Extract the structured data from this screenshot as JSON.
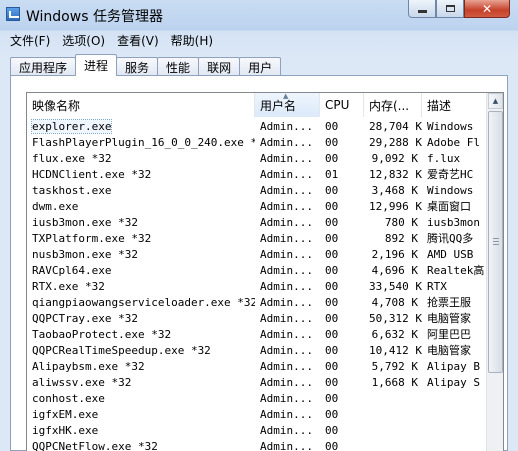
{
  "window": {
    "title": "Windows 任务管理器"
  },
  "menu": [
    "文件(F)",
    "选项(O)",
    "查看(V)",
    "帮助(H)"
  ],
  "tabs": [
    {
      "label": "应用程序",
      "active": false
    },
    {
      "label": "进程",
      "active": true
    },
    {
      "label": "服务",
      "active": false
    },
    {
      "label": "性能",
      "active": false
    },
    {
      "label": "联网",
      "active": false
    },
    {
      "label": "用户",
      "active": false
    }
  ],
  "columns": [
    "映像名称",
    "用户名",
    "CPU",
    "内存(...",
    "描述"
  ],
  "sorted_column": "用户名",
  "rows": [
    {
      "name": "explorer.exe",
      "user": "Admin...",
      "cpu": "00",
      "mem": "28,704 K",
      "desc": "Windows"
    },
    {
      "name": "FlashPlayerPlugin_16_0_0_240.exe *32",
      "user": "Admin...",
      "cpu": "00",
      "mem": "29,288 K",
      "desc": "Adobe Fl"
    },
    {
      "name": "flux.exe *32",
      "user": "Admin...",
      "cpu": "00",
      "mem": "9,092 K",
      "desc": "f.lux"
    },
    {
      "name": "HCDNClient.exe *32",
      "user": "Admin...",
      "cpu": "01",
      "mem": "12,832 K",
      "desc": "爱奇艺HC"
    },
    {
      "name": "taskhost.exe",
      "user": "Admin...",
      "cpu": "00",
      "mem": "3,468 K",
      "desc": "Windows"
    },
    {
      "name": "dwm.exe",
      "user": "Admin...",
      "cpu": "00",
      "mem": "12,996 K",
      "desc": "桌面窗口"
    },
    {
      "name": "iusb3mon.exe *32",
      "user": "Admin...",
      "cpu": "00",
      "mem": "780 K",
      "desc": "iusb3mon"
    },
    {
      "name": "TXPlatform.exe *32",
      "user": "Admin...",
      "cpu": "00",
      "mem": "892 K",
      "desc": "腾讯QQ多"
    },
    {
      "name": "nusb3mon.exe *32",
      "user": "Admin...",
      "cpu": "00",
      "mem": "2,196 K",
      "desc": "AMD USB"
    },
    {
      "name": "RAVCpl64.exe",
      "user": "Admin...",
      "cpu": "00",
      "mem": "4,696 K",
      "desc": "Realtek高"
    },
    {
      "name": "RTX.exe *32",
      "user": "Admin...",
      "cpu": "00",
      "mem": "33,540 K",
      "desc": "RTX"
    },
    {
      "name": "qiangpiaowangserviceloader.exe *32",
      "user": "Admin...",
      "cpu": "00",
      "mem": "4,708 K",
      "desc": "抢票王服"
    },
    {
      "name": "QQPCTray.exe *32",
      "user": "Admin...",
      "cpu": "00",
      "mem": "50,312 K",
      "desc": "电脑管家"
    },
    {
      "name": "TaobaoProtect.exe *32",
      "user": "Admin...",
      "cpu": "00",
      "mem": "6,632 K",
      "desc": "阿里巴巴"
    },
    {
      "name": "QQPCRealTimeSpeedup.exe *32",
      "user": "Admin...",
      "cpu": "00",
      "mem": "10,412 K",
      "desc": "电脑管家"
    },
    {
      "name": "Alipaybsm.exe *32",
      "user": "Admin...",
      "cpu": "00",
      "mem": "5,792 K",
      "desc": "Alipay B"
    },
    {
      "name": "aliwssv.exe *32",
      "user": "Admin...",
      "cpu": "00",
      "mem": "1,668 K",
      "desc": "Alipay S"
    },
    {
      "name": "conhost.exe",
      "user": "Admin...",
      "cpu": "00",
      "mem": "",
      "desc": ""
    },
    {
      "name": "igfxEM.exe",
      "user": "Admin...",
      "cpu": "00",
      "mem": "",
      "desc": ""
    },
    {
      "name": "igfxHK.exe",
      "user": "Admin...",
      "cpu": "00",
      "mem": "",
      "desc": ""
    },
    {
      "name": "QQPCNetFlow.exe *32",
      "user": "Admin...",
      "cpu": "00",
      "mem": "",
      "desc": ""
    }
  ],
  "icons": {
    "window": "task-manager-icon",
    "sort": "sort-arrow-icon"
  }
}
